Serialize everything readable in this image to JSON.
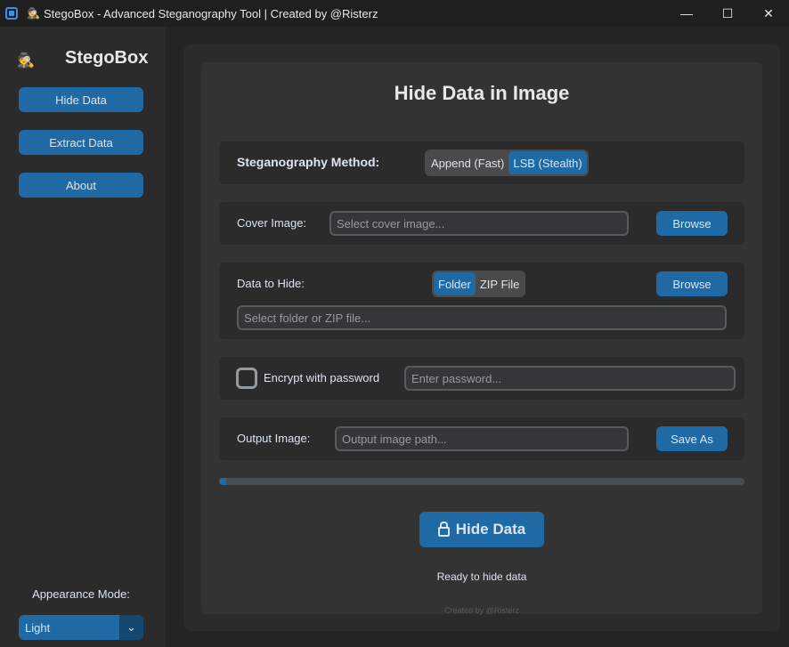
{
  "window": {
    "title": "StegoBox - Advanced Steganography Tool | Created by @Risterz",
    "title_emoji": "🕵",
    "controls": {
      "minimize": "—",
      "maximize": "☐",
      "close": "✕"
    }
  },
  "sidebar": {
    "logo_icon": "🕵",
    "logo_text": "StegoBox",
    "nav": [
      {
        "label": "Hide Data"
      },
      {
        "label": "Extract Data"
      },
      {
        "label": "About"
      }
    ],
    "appearance_label": "Appearance Mode:",
    "appearance_value": "Light",
    "appearance_arrow": "⌄"
  },
  "main": {
    "heading": "Hide Data in Image",
    "method": {
      "label": "Steganography Method:",
      "options": [
        "Append (Fast)",
        "LSB (Stealth)"
      ],
      "selected": "LSB (Stealth)"
    },
    "cover": {
      "label": "Cover Image:",
      "placeholder": "Select cover image...",
      "button": "Browse"
    },
    "data": {
      "label": "Data to Hide:",
      "options": [
        "Folder",
        "ZIP File"
      ],
      "selected": "Folder",
      "button": "Browse",
      "placeholder": "Select folder or ZIP file..."
    },
    "encrypt": {
      "label": "Encrypt with password",
      "checked": false,
      "placeholder": "Enter password..."
    },
    "output": {
      "label": "Output Image:",
      "placeholder": "Output image path...",
      "button": "Save As"
    },
    "progress": 0.01,
    "hide_button": "Hide Data",
    "status": "Ready to hide data",
    "credit": "Created by @Risterz"
  },
  "colors": {
    "accent": "#1f6aa5",
    "background": "#242424",
    "panel": "#2b2b2b"
  }
}
